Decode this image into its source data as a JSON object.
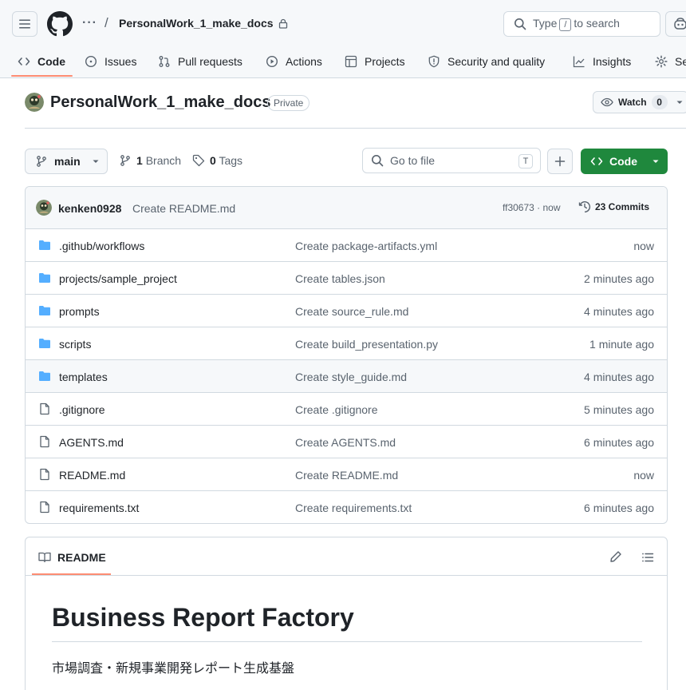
{
  "header": {
    "owner_dots": "···",
    "separator": "/",
    "repo_name": "PersonalWork_1_make_docs",
    "search_prefix": "Type",
    "search_key": "/",
    "search_suffix": "to search"
  },
  "tabs": [
    {
      "label": "Code",
      "icon": "code-icon"
    },
    {
      "label": "Issues",
      "icon": "issue-icon"
    },
    {
      "label": "Pull requests",
      "icon": "pull-request-icon"
    },
    {
      "label": "Actions",
      "icon": "play-icon"
    },
    {
      "label": "Projects",
      "icon": "table-icon"
    },
    {
      "label": "Security and quality",
      "icon": "shield-icon"
    },
    {
      "label": "Insights",
      "icon": "graph-icon"
    },
    {
      "label": "Se",
      "icon": "gear-icon"
    }
  ],
  "repo": {
    "title": "PersonalWork_1_make_docs",
    "visibility": "Private",
    "watch_label": "Watch",
    "watch_count": "0"
  },
  "controls": {
    "branch": "main",
    "branches_count": "1",
    "branches_label": "Branch",
    "tags_count": "0",
    "tags_label": "Tags",
    "goto_placeholder": "Go to file",
    "goto_key": "T",
    "code_label": "Code"
  },
  "latest_commit": {
    "user": "kenken0928",
    "message": "Create README.md",
    "hash_time": "ff30673 · now",
    "commits_label": "23 Commits"
  },
  "files": [
    {
      "name": ".github/workflows",
      "type": "folder",
      "message": "Create package-artifacts.yml",
      "time": "now"
    },
    {
      "name": "projects/sample_project",
      "type": "folder",
      "message": "Create tables.json",
      "time": "2 minutes ago"
    },
    {
      "name": "prompts",
      "type": "folder",
      "message": "Create source_rule.md",
      "time": "4 minutes ago"
    },
    {
      "name": "scripts",
      "type": "folder",
      "message": "Create build_presentation.py",
      "time": "1 minute ago"
    },
    {
      "name": "templates",
      "type": "folder",
      "message": "Create style_guide.md",
      "time": "4 minutes ago"
    },
    {
      "name": ".gitignore",
      "type": "file",
      "message": "Create .gitignore",
      "time": "5 minutes ago"
    },
    {
      "name": "AGENTS.md",
      "type": "file",
      "message": "Create AGENTS.md",
      "time": "6 minutes ago"
    },
    {
      "name": "README.md",
      "type": "file",
      "message": "Create README.md",
      "time": "now"
    },
    {
      "name": "requirements.txt",
      "type": "file",
      "message": "Create requirements.txt",
      "time": "6 minutes ago"
    }
  ],
  "readme": {
    "tab_label": "README",
    "heading": "Business Report Factory",
    "paragraph": "市場調査・新規事業開発レポート生成基盤"
  },
  "colors": {
    "accent_green": "#1f883d",
    "folder_blue": "#54aeff",
    "tab_underline": "#fd8c73"
  }
}
